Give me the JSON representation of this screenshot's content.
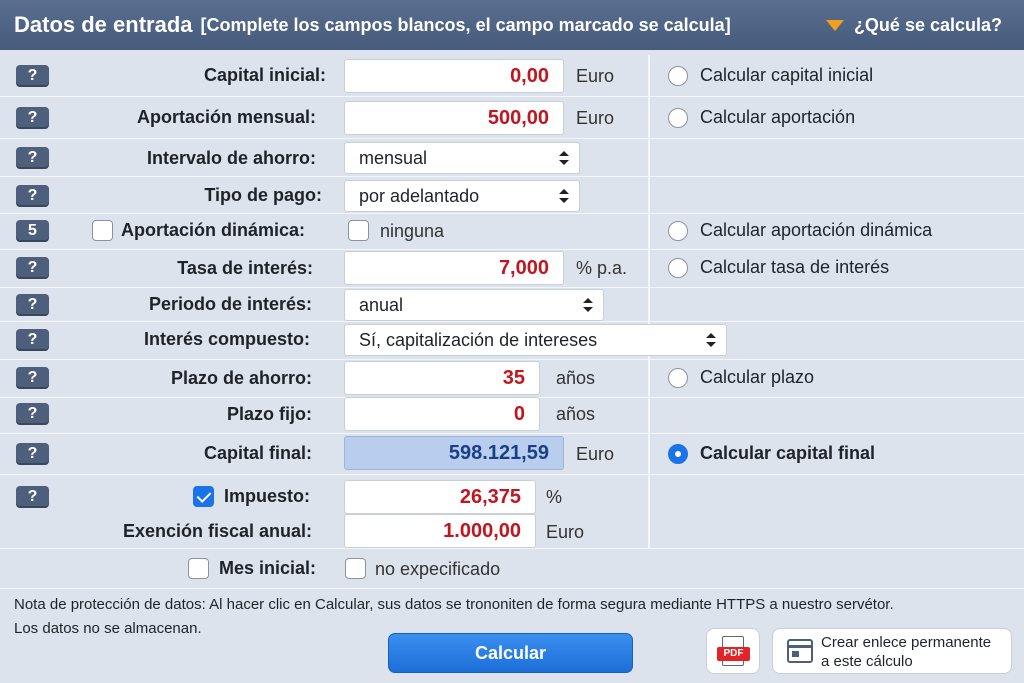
{
  "header": {
    "title": "Datos de entrada",
    "subtitle": "[Complete los campos blancos, el campo marcado se calcula]",
    "what_link": "¿Qué se calcula?"
  },
  "help_button": "?",
  "help_button_5": "5",
  "rows": {
    "capital_inicial": {
      "label": "Capital inicial:",
      "value": "0,00",
      "unit": "Euro",
      "radio": "Calcular capital inicial"
    },
    "aportacion": {
      "label": "Aportación mensual:",
      "value": "500,00",
      "unit": "Euro",
      "radio": "Calcular aportación"
    },
    "intervalo": {
      "label": "Intervalo de ahorro:",
      "selected": "mensual"
    },
    "tipo_pago": {
      "label": "Tipo de pago:",
      "selected": "por adelantado"
    },
    "dinamica": {
      "label": "Aportación dinámica:",
      "option": "ninguna",
      "radio": "Calcular aportación dinámica"
    },
    "tasa": {
      "label": "Tasa de interés:",
      "value": "7,000",
      "unit": "% p.a.",
      "radio": "Calcular tasa de interés"
    },
    "periodo": {
      "label": "Periodo de interés:",
      "selected": "anual"
    },
    "compuesto": {
      "label": "Interés compuesto:",
      "selected": "Sí, capitalización de intereses"
    },
    "plazo": {
      "label": "Plazo de ahorro:",
      "value": "35",
      "unit": "años",
      "radio": "Calcular plazo"
    },
    "plazo_fijo": {
      "label": "Plazo fijo:",
      "value": "0",
      "unit": "años"
    },
    "capital_final": {
      "label": "Capital final:",
      "value": "598.121,59",
      "unit": "Euro",
      "radio": "Calcular capital final"
    },
    "impuesto": {
      "label": "Impuesto:",
      "value": "26,375",
      "unit": "%",
      "checked": true
    },
    "exencion": {
      "label": "Exención fiscal anual:",
      "value": "1.000,00",
      "unit": "Euro"
    },
    "mes_inicial": {
      "label": "Mes inicial:",
      "option": "no expecificado"
    }
  },
  "note": {
    "line1": "Nota de protección de datos: Al hacer clic en Calcular, sus datos se trononiten de forma segura mediante HTTPS a nuestro servétor.",
    "line2": "Los datos no se almacenan."
  },
  "buttons": {
    "calcular": "Calcular",
    "pdf": "PDF",
    "permalink_1": "Crear enlece permanente",
    "permalink_2": "a este cálculo"
  },
  "colors": {
    "accent": "#1a73e8",
    "value_red": "#c0161f",
    "header": "#4d6282"
  }
}
